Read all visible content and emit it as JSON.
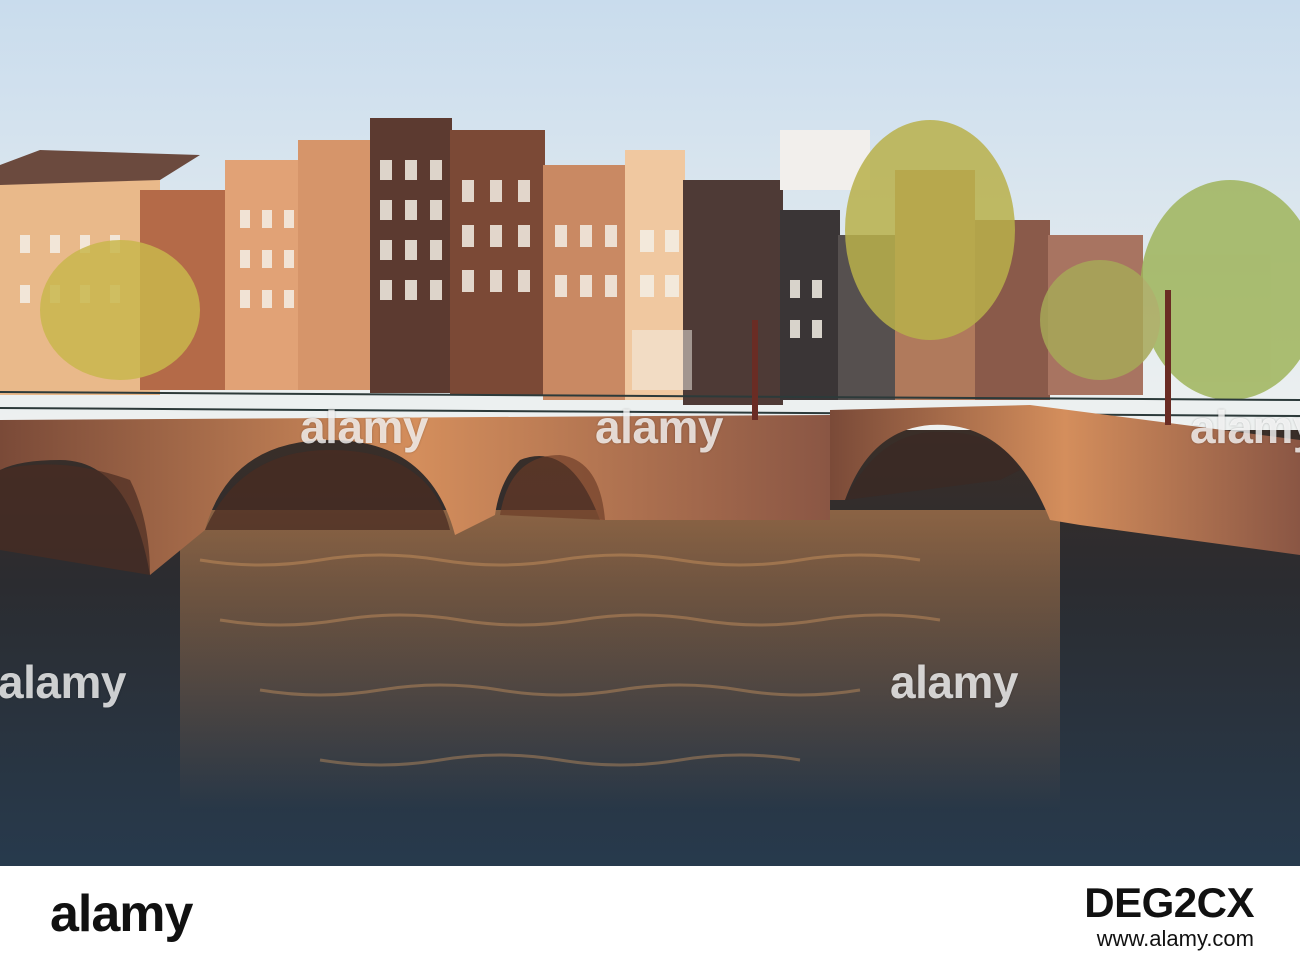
{
  "watermark": {
    "text": "alamy"
  },
  "footer": {
    "logo": "alamy",
    "image_id": "DEG2CX",
    "url": "www.alamy.com"
  },
  "colors": {
    "sky_top": "#dfe9f3",
    "brick": "#9a5a3c",
    "water": "#2a2f36",
    "glow": "#e8a868"
  }
}
